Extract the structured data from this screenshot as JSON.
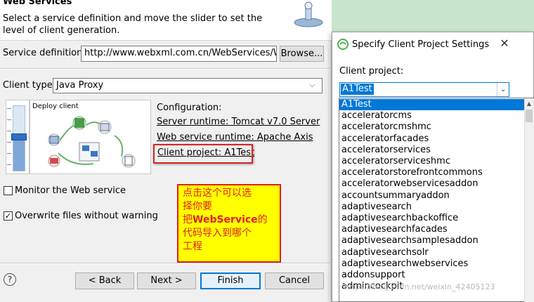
{
  "wizard": {
    "title": "Web Services",
    "description": "Select a service definition and move the slider to set the level of client generation.",
    "service_definition_label": "Service definition:",
    "service_definition_value": "http://www.webxml.com.cn/WebServices/W",
    "browse_label": "Browse...",
    "client_type_label": "Client type:",
    "client_type_value": "Java Proxy",
    "slider_level_label": "Deploy client",
    "configuration_label": "Configuration:",
    "server_runtime": "Server runtime: Tomcat v7.0 Server",
    "web_service_runtime": "Web service runtime: Apache Axis",
    "client_project": "Client project: A1Test",
    "monitor_label": "Monitor the Web service",
    "monitor_checked": false,
    "overwrite_label": "Overwrite files without warning",
    "overwrite_checked": true,
    "buttons": {
      "help": "?",
      "back": "< Back",
      "next": "Next >",
      "finish": "Finish",
      "cancel": "Cancel"
    }
  },
  "annotation": {
    "line1": "点击这个可以选",
    "line2": "择你要",
    "line3_prefix": "把",
    "line3_bold": "WebService",
    "line3_suffix": "的",
    "line4": "代码导入到哪个",
    "line5": "工程",
    "color": "#e02020",
    "background": "#ffff00"
  },
  "project_dialog": {
    "title": "Specify Client Project Settings",
    "client_project_label": "Client project:",
    "selected": "A1Test",
    "options": [
      "A1Test",
      "acceleratorcms",
      "acceleratorcmshmc",
      "acceleratorfacades",
      "acceleratorservices",
      "acceleratorserviceshmc",
      "acceleratorstorefrontcommons",
      "acceleratorwebservicesaddon",
      "accountsummaryaddon",
      "adaptivesearch",
      "adaptivesearchbackoffice",
      "adaptivesearchfacades",
      "adaptivesearchsamplesaddon",
      "adaptivesearchsolr",
      "adaptivesearchwebservices",
      "addonsupport",
      "admincockpit"
    ]
  },
  "watermark": "https://blog.csdn.net/weixin_42405123",
  "colors": {
    "accent": "#0078d7",
    "highlight": "#e02020",
    "desktop": "#c7e6cd"
  }
}
